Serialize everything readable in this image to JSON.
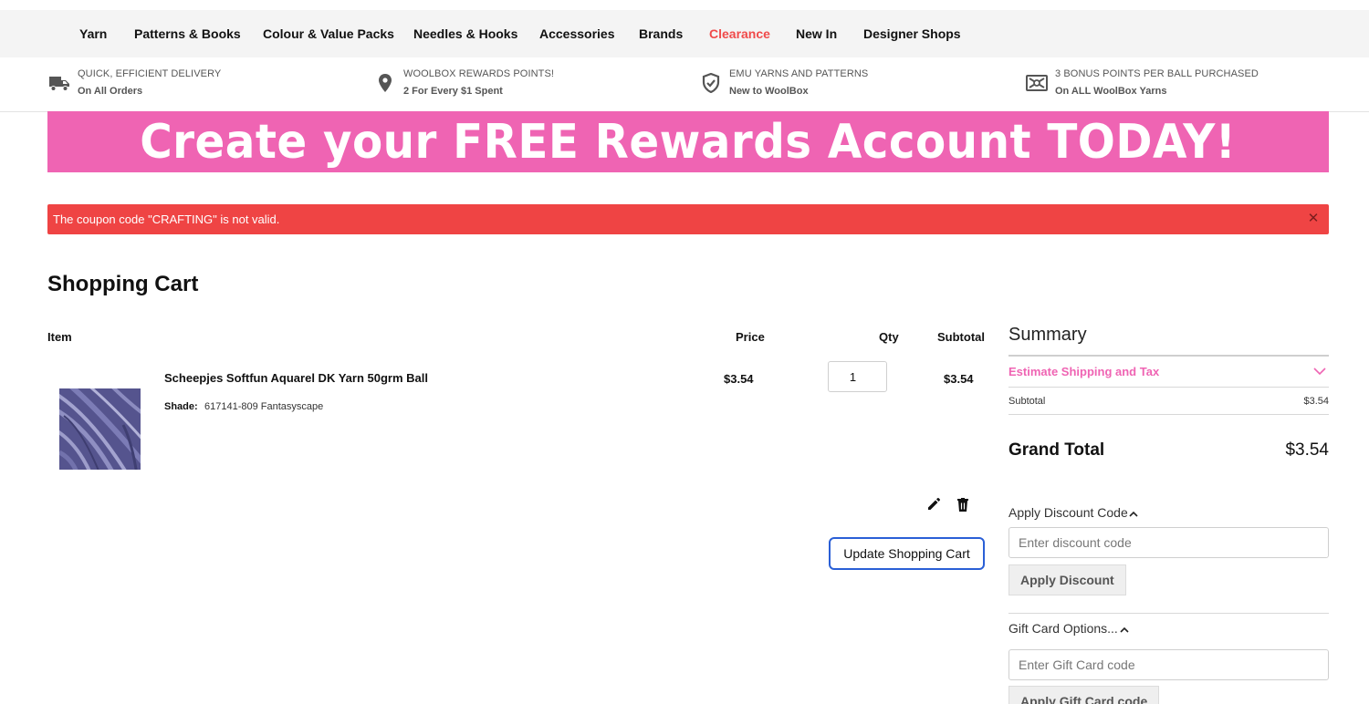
{
  "nav": {
    "items": [
      "Yarn",
      "Patterns & Books",
      "Colour & Value Packs",
      "Needles & Hooks",
      "Accessories",
      "Brands",
      "Clearance",
      "New In",
      "Designer Shops"
    ],
    "sale_color": "#f04a4a"
  },
  "usp": [
    {
      "icon": "truck-icon",
      "title": "QUICK, EFFICIENT DELIVERY",
      "sub": "On All Orders"
    },
    {
      "icon": "map-pin-icon",
      "title": "WOOLBOX REWARDS POINTS!",
      "sub": "2 For Every $1 Spent"
    },
    {
      "icon": "shield-check-icon",
      "title": "EMU YARNS AND PATTERNS",
      "sub": "New to WoolBox"
    },
    {
      "icon": "yarn-ticket-icon",
      "title": "3 BONUS POINTS PER BALL PURCHASED",
      "sub": "On ALL WoolBox Yarns"
    }
  ],
  "banner": {
    "text": "Create your FREE Rewards Account TODAY!",
    "color": "#ef64b3"
  },
  "error": {
    "message": "The coupon code \"CRAFTING\" is not valid.",
    "close": "✕",
    "color": "#ef4444"
  },
  "page_title": "Shopping Cart",
  "cart": {
    "headers": {
      "item": "Item",
      "price": "Price",
      "qty": "Qty",
      "subtotal": "Subtotal"
    },
    "items": [
      {
        "name": "Scheepjes Softfun Aquarel DK Yarn 50grm Ball",
        "shade_label": "Shade:",
        "shade_value": "617141-809 Fantasyscape",
        "price": "$3.54",
        "qty": "1",
        "subtotal": "$3.54"
      }
    ],
    "update_button": "Update Shopping Cart"
  },
  "summary": {
    "title": "Summary",
    "estimate_label": "Estimate Shipping and Tax",
    "subtotal_label": "Subtotal",
    "subtotal_value": "$3.54",
    "grand_total_label": "Grand Total",
    "grand_total_value": "$3.54",
    "discount": {
      "label": "Apply Discount Code",
      "placeholder": "Enter discount code",
      "button": "Apply Discount"
    },
    "gift": {
      "label": "Gift Card Options...",
      "placeholder": "Enter Gift Card code",
      "button": "Apply Gift Card code"
    },
    "accent_color": "#ef64b3"
  }
}
